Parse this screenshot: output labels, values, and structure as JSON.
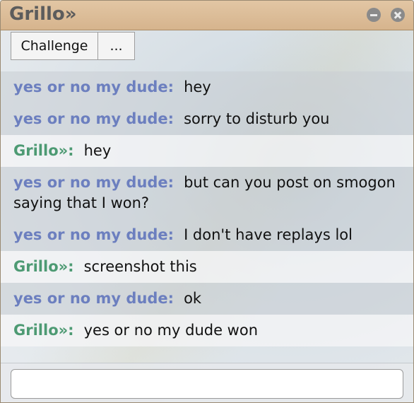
{
  "window": {
    "title": "Grillo»"
  },
  "tabs": [
    {
      "label": "Challenge"
    },
    {
      "label": "..."
    }
  ],
  "colors": {
    "titlebar": "#d9b892",
    "name_blue": "#6c7fbf",
    "name_green": "#4d9a73"
  },
  "messages": [
    {
      "user": "yes or no my dude:",
      "text": "hey",
      "color": "blue",
      "shade": true
    },
    {
      "user": "yes or no my dude:",
      "text": "sorry to disturb you",
      "color": "blue",
      "shade": true
    },
    {
      "user": "Grillo»:",
      "text": "hey",
      "color": "green",
      "shade": false
    },
    {
      "user": "yes or no my dude:",
      "text": "but can you post on smogon saying that I won?",
      "color": "blue",
      "shade": true
    },
    {
      "user": "yes or no my dude:",
      "text": "I don't have replays lol",
      "color": "blue",
      "shade": true
    },
    {
      "user": "Grillo»:",
      "text": "screenshot this",
      "color": "green",
      "shade": false
    },
    {
      "user": "yes or no my dude:",
      "text": "ok",
      "color": "blue",
      "shade": true
    },
    {
      "user": "Grillo»:",
      "text": "yes or no my dude won",
      "color": "green",
      "shade": false
    }
  ],
  "input": {
    "value": "",
    "placeholder": ""
  },
  "icons": {
    "minimize": "minimize-icon",
    "close": "close-icon"
  }
}
